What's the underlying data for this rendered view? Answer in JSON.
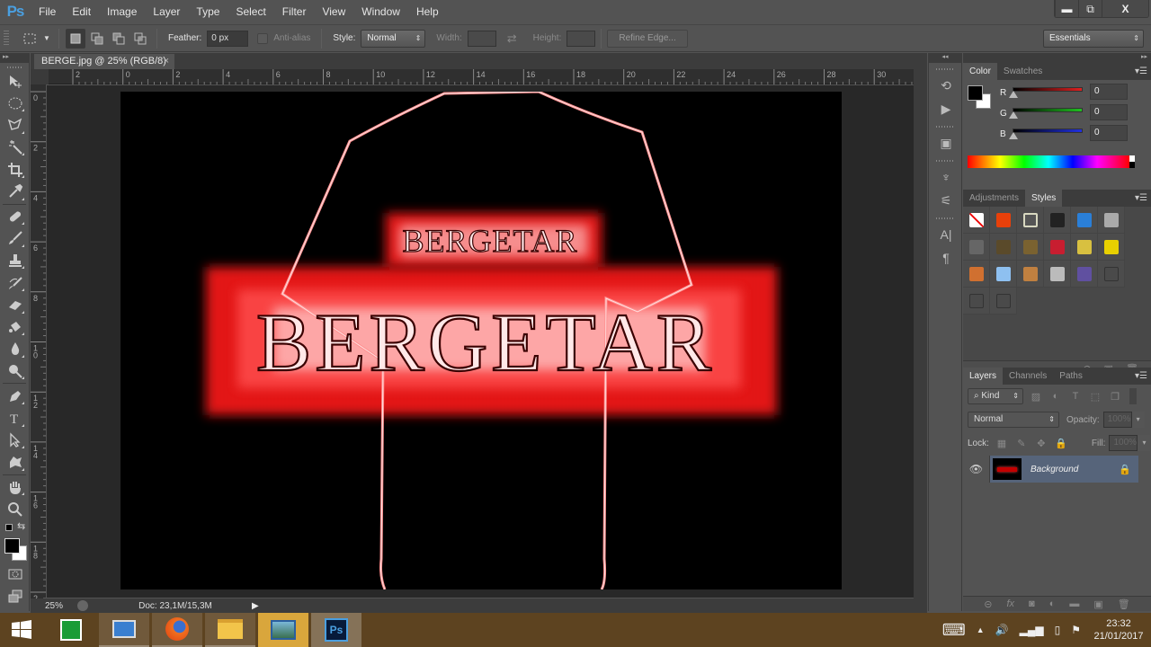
{
  "app": {
    "logo": "Ps"
  },
  "menu": [
    "File",
    "Edit",
    "Image",
    "Layer",
    "Type",
    "Select",
    "Filter",
    "View",
    "Window",
    "Help"
  ],
  "window_controls": {
    "minimize": "▬",
    "restore": "⧉",
    "close": "X"
  },
  "options_bar": {
    "feather_label": "Feather:",
    "feather_value": "0 px",
    "anti_alias_label": "Anti-alias",
    "style_label": "Style:",
    "style_value": "Normal",
    "width_label": "Width:",
    "height_label": "Height:",
    "refine_edge_label": "Refine Edge...",
    "workspace_value": "Essentials"
  },
  "document": {
    "tab_title": "BERGE.jpg @ 25% (RGB/8)",
    "tab_close": "×",
    "ruler_h": [
      "2",
      "0",
      "2",
      "4",
      "6",
      "8",
      "10",
      "12",
      "14",
      "16",
      "18",
      "20",
      "22",
      "24",
      "26",
      "28",
      "30"
    ],
    "ruler_v": [
      "0",
      "2",
      "4",
      "6",
      "8",
      "10",
      "12",
      "14",
      "16",
      "18",
      "2"
    ],
    "artwork": {
      "text_small": "BERGETAR",
      "text_large": "BERGETAR"
    }
  },
  "status": {
    "zoom": "25%",
    "doc_info": "Doc: 23,1M/15,3M"
  },
  "color_panel": {
    "tabs": [
      "Color",
      "Swatches"
    ],
    "active_tab": "Color",
    "channels": [
      {
        "label": "R",
        "value": "0",
        "color": "#e02020"
      },
      {
        "label": "G",
        "value": "0",
        "color": "#20c020"
      },
      {
        "label": "B",
        "value": "0",
        "color": "#2030e0"
      }
    ],
    "foreground": "#000000",
    "background": "#ffffff"
  },
  "styles_panel": {
    "tabs": [
      "Adjustments",
      "Styles"
    ],
    "active_tab": "Styles",
    "swatches": [
      "none",
      "#e8400a",
      "#555555",
      "#222222",
      "#2a7fd8",
      "#aaaaaa",
      "#666666",
      "#5a4a2a",
      "#7a6230",
      "#c81e30",
      "#d8c040",
      "#e8d000",
      "#d07030",
      "#8ec0f0",
      "#c08040",
      "#bbbbbb",
      "#6050a0",
      "#4a4a4a",
      "#4a4a4a",
      "#4a4a4a"
    ]
  },
  "layers_panel": {
    "tabs": [
      "Layers",
      "Channels",
      "Paths"
    ],
    "active_tab": "Layers",
    "filter_kind": "Kind",
    "blend_mode": "Normal",
    "opacity_label": "Opacity:",
    "opacity_value": "100%",
    "lock_label": "Lock:",
    "fill_label": "Fill:",
    "fill_value": "100%",
    "layers": [
      {
        "name": "Background",
        "visible": true,
        "locked": true
      }
    ]
  },
  "taskbar": {
    "apps": [
      "Start",
      "Store",
      "Remote Desktop",
      "Firefox",
      "File Explorer",
      "Photos",
      "Photoshop"
    ],
    "time": "23:32",
    "date": "21/01/2017"
  }
}
